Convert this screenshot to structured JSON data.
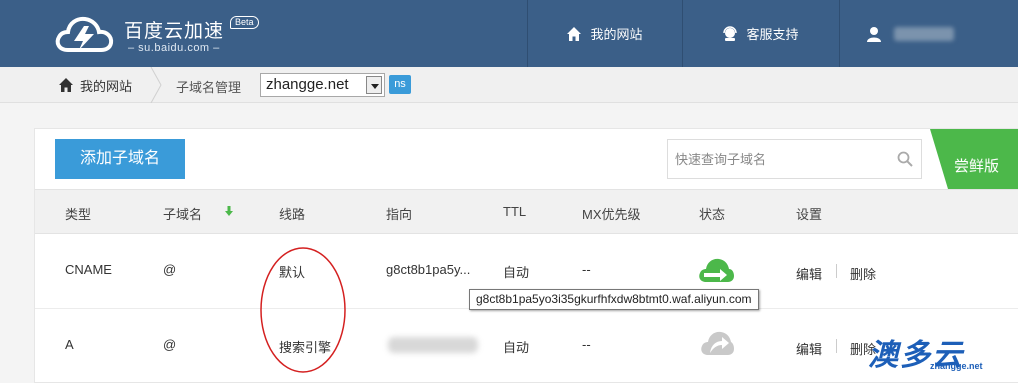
{
  "header": {
    "logo_title": "百度云加速",
    "logo_sub": "– su.baidu.com –",
    "logo_badge": "Beta",
    "nav": [
      {
        "label": "我的网站",
        "icon": "home-icon"
      },
      {
        "label": "客服支持",
        "icon": "support-icon"
      },
      {
        "label": "",
        "icon": "user-icon"
      }
    ],
    "bg_color": "#3b5f88"
  },
  "breadcrumb": {
    "home_label": "我的网站",
    "current_label": "子域名管理",
    "selected_domain": "zhangge.net",
    "ns_badge": "ns"
  },
  "toolbar": {
    "add_button": "添加子域名",
    "search_placeholder": "快速查询子域名",
    "ribbon_label": "尝鲜版",
    "accent_color": "#3a9bd9",
    "ribbon_color": "#4cb84a"
  },
  "table": {
    "columns": [
      "类型",
      "子域名",
      "线路",
      "指向",
      "TTL",
      "MX优先级",
      "状态",
      "设置"
    ],
    "rows": [
      {
        "type": "CNAME",
        "name": "@",
        "line": "默认",
        "target": "g8ct8b1pa5y...",
        "ttl": "自动",
        "mx": "--",
        "status": "cloud-accelerated",
        "edit": "编辑",
        "delete": "删除"
      },
      {
        "type": "A",
        "name": "@",
        "line": "搜索引擎",
        "target": "",
        "ttl": "自动",
        "mx": "--",
        "status": "cloud-inactive",
        "edit": "编辑",
        "delete": "删除"
      }
    ]
  },
  "tooltip": {
    "text": "g8ct8b1pa5yo3i35gkurfhfxdw8btmt0.waf.aliyun.com"
  },
  "watermark": {
    "text": "澳多云",
    "sub": "zhangge.net"
  }
}
